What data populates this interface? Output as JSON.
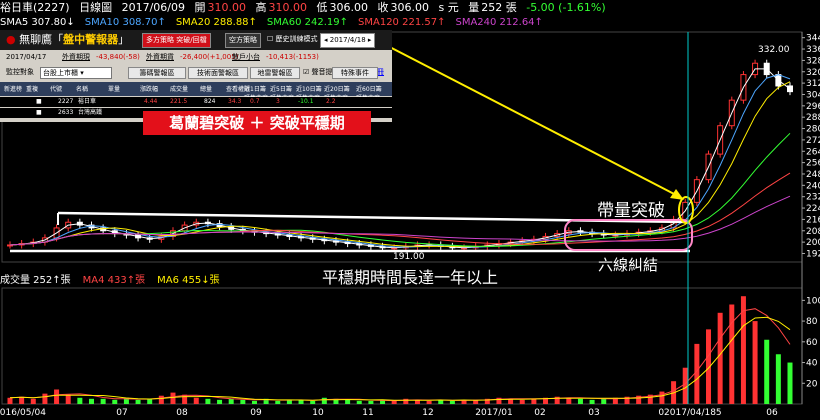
{
  "header": {
    "stock": "裕日車(2227)",
    "period": "日線圖",
    "date": "2017/06/09",
    "open_label": "開",
    "open": "310.00",
    "high_label": "高",
    "high": "310.00",
    "low_label": "低",
    "low": "306.00",
    "close_label": "收",
    "close": "306.00",
    "unit": "s 元",
    "vol_label": "量",
    "volume": "252 張",
    "change": "-5.00 (-1.61%)"
  },
  "ma_legend": [
    {
      "label": "SMA5",
      "value": "307.80",
      "arrow": "↓",
      "color": "#ffffff"
    },
    {
      "label": "SMA10",
      "value": "308.70",
      "arrow": "↑",
      "color": "#4da6ff"
    },
    {
      "label": "SMA20",
      "value": "288.88",
      "arrow": "↑",
      "color": "#ffee00"
    },
    {
      "label": "SMA60",
      "value": "242.19",
      "arrow": "↑",
      "color": "#33ff33"
    },
    {
      "label": "SMA120",
      "value": "221.57",
      "arrow": "↑",
      "color": "#ff4444"
    },
    {
      "label": "SMA240",
      "value": "212.64",
      "arrow": "↑",
      "color": "#cc44cc"
    }
  ],
  "panel": {
    "logo_pre": "無聊鷹「",
    "logo_main": "盤中警報器",
    "logo_post": "」",
    "btn_strategy": "多方策略 突破/回檔",
    "btn_short": "空方策略",
    "chk_history": "歷史訓練模式",
    "date_box": "2017/4/18",
    "row1_date": "2017/04/17",
    "row1_ext_label": "外資期現",
    "row1_ext_val": "-43,840(-58)",
    "row1_inst_label": "外資期貨",
    "row1_inst_val": "-26,400(+1,005)",
    "row1_retail_label": "散戶小台",
    "row1_retail_val": "-10,413(-1153)",
    "row2_monitor": "監控對象",
    "row2_select": "台股上市櫃",
    "row2_btn1": "籌碼警報區",
    "row2_btn2": "技術面警報區",
    "row2_btn3": "地雷警報區",
    "row2_btn4": "特殊事件",
    "chk_sound": "聲音提示",
    "link_manual": "手冊",
    "grid_headers": [
      "新進榜",
      "重複",
      "代號",
      "名稱",
      "單量",
      "漲跌幅",
      "成交量",
      "總量",
      "查看權限",
      "近1日籌碼集中度",
      "近5日籌碼集中度",
      "近10日籌碼集中度",
      "近20日籌碼集中度",
      "近60日籌碼集中度"
    ],
    "grid_rows": [
      [
        "",
        "■",
        "2227",
        "裕日車",
        "",
        "4.44",
        "221.5",
        "824",
        "34.3",
        "0.7",
        "3",
        "-10.1",
        "2.2"
      ],
      [
        "",
        "■",
        "2633",
        "台灣高鐵",
        "",
        "",
        "",
        "",
        "",
        "",
        "",
        "",
        ""
      ]
    ]
  },
  "banner": "葛蘭碧突破 ＋ 突破平穩期",
  "annotations": {
    "breakout": "帶量突破",
    "six_lines": "六線糾結",
    "flat_period": "平穩期時間長達一年以上",
    "peak": "332.00",
    "trough": "191.00"
  },
  "volume_legend": [
    {
      "label": "成交量",
      "value": "252",
      "arrow": "↑張",
      "color": "#ffffff"
    },
    {
      "label": "MA4",
      "value": "433",
      "arrow": "↑張",
      "color": "#ff4444"
    },
    {
      "label": "MA6",
      "value": "455",
      "arrow": "↓張",
      "color": "#ffee00"
    }
  ],
  "chart_data": {
    "type": "line",
    "price_axis_ticks": [
      192,
      200,
      208,
      216,
      224,
      232,
      240,
      248,
      256,
      264,
      272,
      280,
      288,
      296,
      304,
      312,
      320,
      328,
      336,
      344
    ],
    "volume_axis_ticks": [
      100,
      80,
      60,
      40,
      20
    ],
    "x_tick_labels": [
      "2016/05/04",
      "07",
      "08",
      "09",
      "10",
      "11",
      "12",
      "2017/01",
      "02",
      "03",
      "02017/04/185",
      "06"
    ],
    "ylim": [
      186,
      348
    ],
    "volume_ylim": [
      0,
      110
    ],
    "close_series_approx": [
      198,
      199,
      200,
      203,
      210,
      214,
      212,
      210,
      208,
      206,
      205,
      203,
      202,
      204,
      208,
      212,
      214,
      213,
      211,
      209,
      208,
      207,
      206,
      205,
      204,
      203,
      202,
      201,
      200,
      199,
      198,
      197,
      196,
      196,
      197,
      198,
      198,
      197,
      196,
      196,
      197,
      198,
      199,
      200,
      201,
      202,
      204,
      206,
      208,
      207,
      206,
      205,
      205,
      206,
      207,
      208,
      210,
      216,
      228,
      244,
      262,
      282,
      300,
      318,
      326,
      318,
      310,
      306
    ],
    "volume_series_approx": [
      6,
      7,
      5,
      10,
      14,
      9,
      6,
      5,
      5,
      4,
      6,
      4,
      5,
      8,
      11,
      9,
      6,
      5,
      4,
      5,
      4,
      3,
      5,
      3,
      4,
      4,
      3,
      6,
      5,
      4,
      3,
      3,
      4,
      3,
      5,
      4,
      3,
      4,
      3,
      4,
      4,
      5,
      6,
      5,
      4,
      5,
      6,
      7,
      6,
      5,
      4,
      5,
      6,
      7,
      8,
      9,
      12,
      22,
      35,
      58,
      72,
      88,
      96,
      104,
      80,
      62,
      48,
      40
    ]
  }
}
